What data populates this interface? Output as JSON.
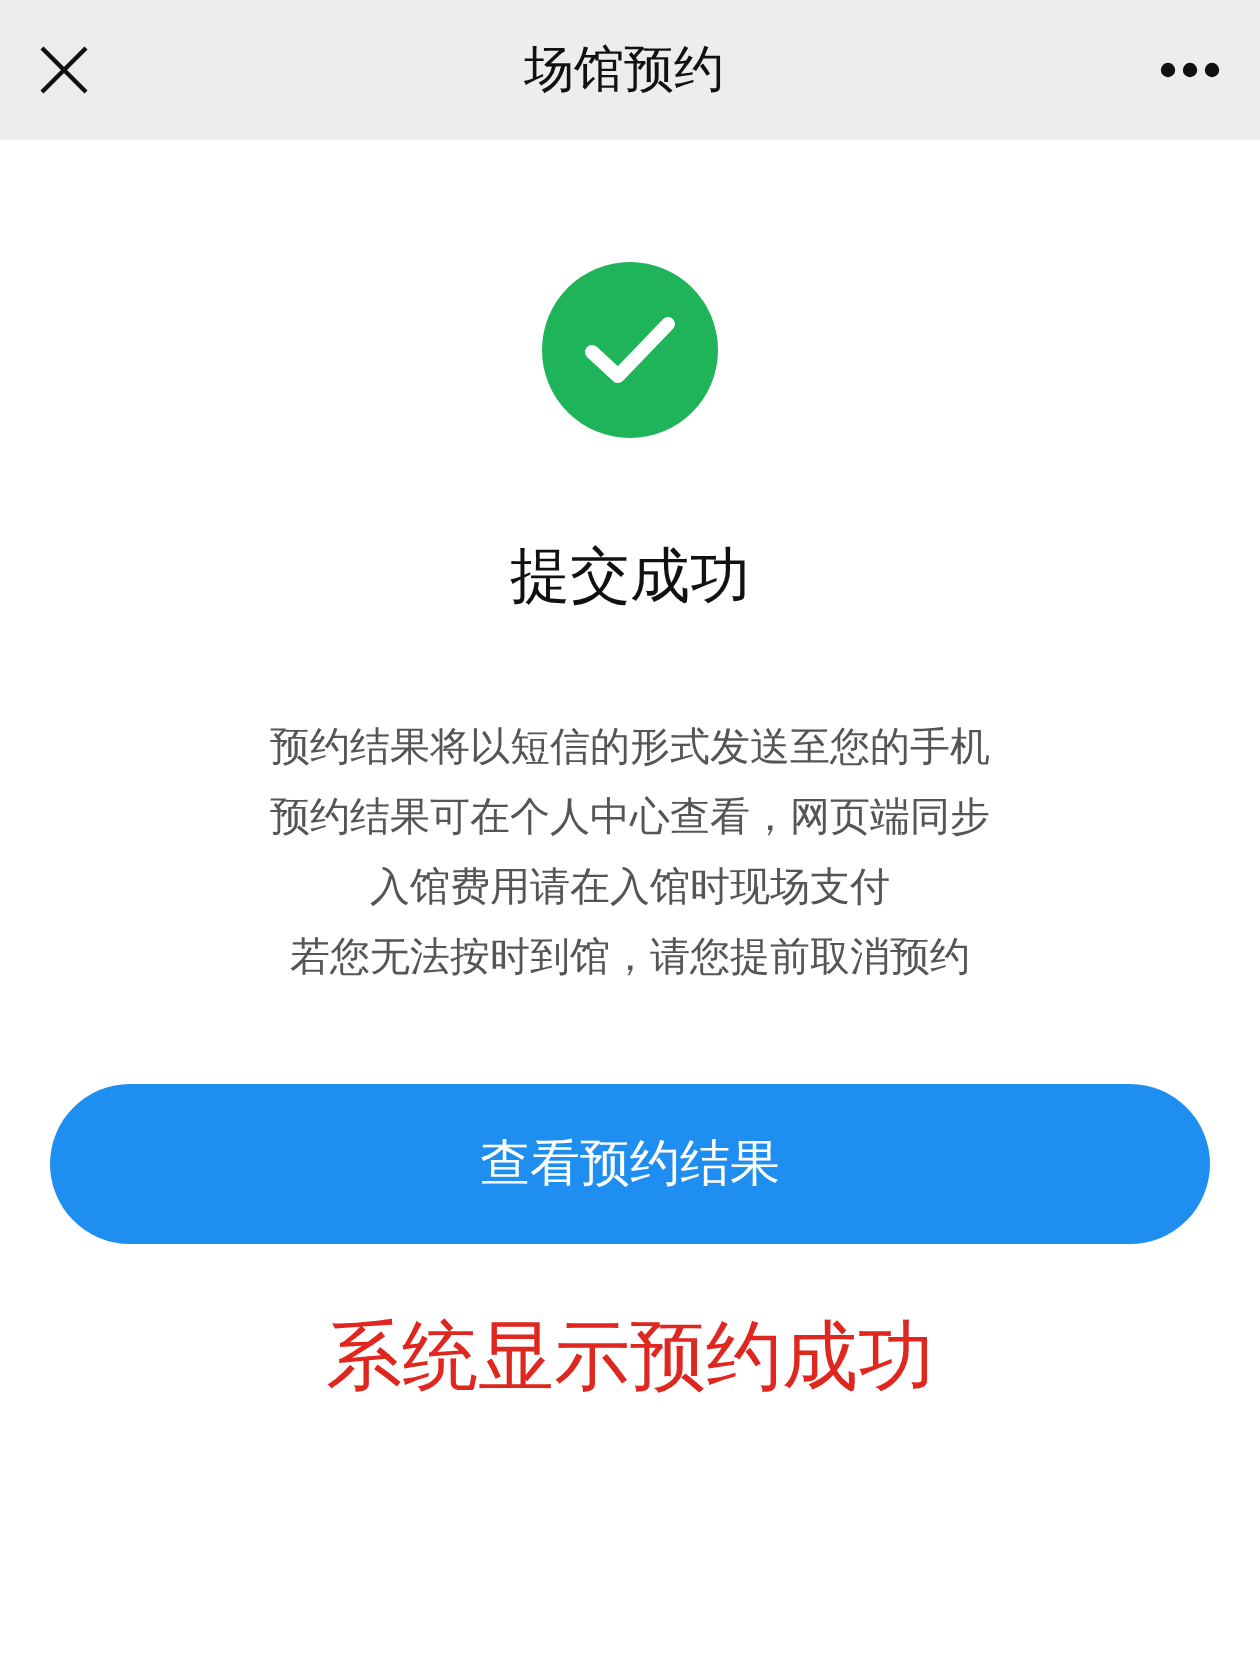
{
  "top_bar": {
    "title": "场馆预约"
  },
  "status": {
    "kind": "success",
    "title": "提交成功"
  },
  "notes": [
    "预约结果将以短信的形式发送至您的手机",
    "预约结果可在个人中心查看，网页端同步",
    "入馆费用请在入馆时现场支付",
    "若您无法按时到馆，请您提前取消预约"
  ],
  "primary_button": {
    "label": "查看预约结果"
  },
  "annotation": {
    "text": "系统显示预约成功"
  }
}
